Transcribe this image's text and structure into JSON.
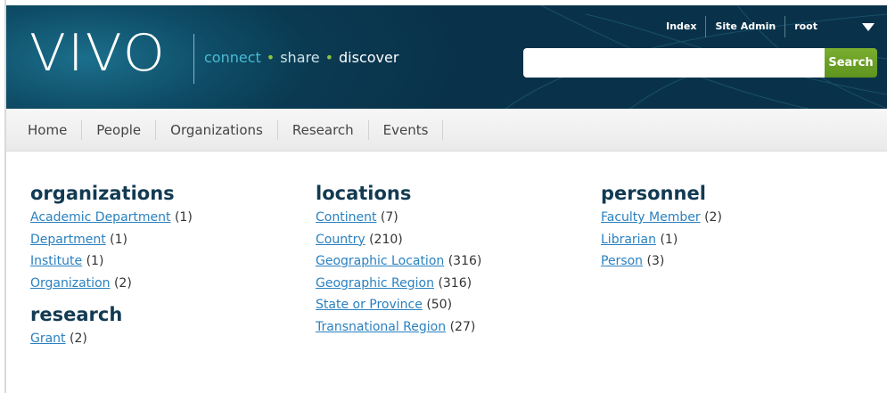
{
  "header": {
    "logo": "VIVO",
    "tagline": {
      "part1": "connect",
      "part2": "share",
      "part3": "discover",
      "separator": "•"
    },
    "user_menu": [
      "Index",
      "Site Admin",
      "root"
    ],
    "search": {
      "value": "",
      "placeholder": "",
      "button_label": "Search"
    }
  },
  "nav": [
    "Home",
    "People",
    "Organizations",
    "Research",
    "Events"
  ],
  "groups": {
    "organizations": {
      "title": "organizations",
      "items": [
        {
          "label": "Academic Department",
          "count": "(1)"
        },
        {
          "label": "Department",
          "count": "(1)"
        },
        {
          "label": "Institute",
          "count": "(1)"
        },
        {
          "label": "Organization",
          "count": "(2)"
        }
      ]
    },
    "research": {
      "title": "research",
      "items": [
        {
          "label": "Grant",
          "count": "(2)"
        }
      ]
    },
    "locations": {
      "title": "locations",
      "items": [
        {
          "label": "Continent",
          "count": "(7)"
        },
        {
          "label": "Country",
          "count": "(210)"
        },
        {
          "label": "Geographic Location",
          "count": "(316)"
        },
        {
          "label": "Geographic Region",
          "count": "(316)"
        },
        {
          "label": "State or Province",
          "count": "(50)"
        },
        {
          "label": "Transnational Region",
          "count": "(27)"
        }
      ]
    },
    "personnel": {
      "title": "personnel",
      "items": [
        {
          "label": "Faculty Member",
          "count": "(2)"
        },
        {
          "label": "Librarian",
          "count": "(1)"
        },
        {
          "label": "Person",
          "count": "(3)"
        }
      ]
    }
  },
  "colors": {
    "header_bg": "#0a3a52",
    "tagline_accent": "#4bbad2",
    "tagline_dot": "#8cc63f",
    "search_button": "#6aa127",
    "link": "#2a81c0",
    "group_title": "#123a52"
  }
}
